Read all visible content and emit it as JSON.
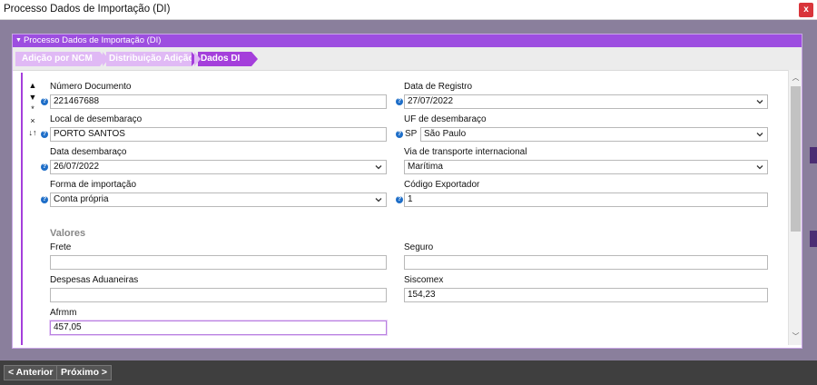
{
  "window": {
    "title": "Processo Dados de Importação (DI)",
    "close_label": "x"
  },
  "panel": {
    "header": "Processo Dados de Importação (DI)"
  },
  "breadcrumb": {
    "items": [
      "Adição por NCM",
      "Distribuição Adição",
      "Dados DI"
    ],
    "active": "Dados DI"
  },
  "toolbar": {
    "up": "▲",
    "down": "▼",
    "star": "*",
    "x": "×",
    "sort": "↓↑"
  },
  "form": {
    "numero_documento": {
      "label": "Número Documento",
      "value": "221467688"
    },
    "data_registro": {
      "label": "Data de Registro",
      "value": "27/07/2022"
    },
    "local_desembaraco": {
      "label": "Local de desembaraço",
      "value": "PORTO SANTOS"
    },
    "uf_desembaraco": {
      "label": "UF de desembaraço",
      "code": "SP",
      "value": "São Paulo"
    },
    "data_desembaraco": {
      "label": "Data desembaraço",
      "value": "26/07/2022"
    },
    "via_transporte": {
      "label": "Via de transporte internacional",
      "value": "Marítima"
    },
    "forma_importacao": {
      "label": "Forma de importação",
      "value": "Conta própria"
    },
    "codigo_exportador": {
      "label": "Código Exportador",
      "value": "1"
    }
  },
  "valores": {
    "title": "Valores",
    "frete": {
      "label": "Frete",
      "value": ""
    },
    "seguro": {
      "label": "Seguro",
      "value": ""
    },
    "despesas_aduaneiras": {
      "label": "Despesas Aduaneiras",
      "value": ""
    },
    "siscomex": {
      "label": "Siscomex",
      "value": "154,23"
    },
    "afrmm": {
      "label": "Afrmm",
      "value": "457,05"
    }
  },
  "footer": {
    "prev": "< Anterior",
    "next": "Próximo >"
  },
  "colors": {
    "accent": "#a43fdb",
    "header": "#9d4ee0",
    "crumb_inactive": "#e0b9f5",
    "help": "#1e6ec8",
    "close": "#d9353b"
  }
}
